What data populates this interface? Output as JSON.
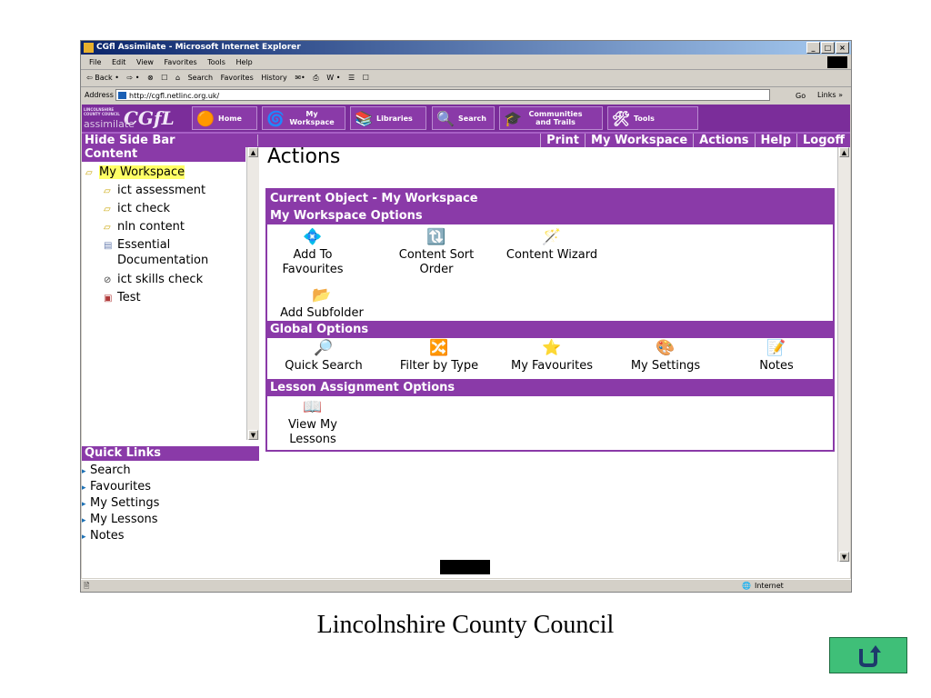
{
  "browser": {
    "title": "CGfl Assimilate - Microsoft Internet Explorer",
    "menu": [
      "File",
      "Edit",
      "View",
      "Favorites",
      "Tools",
      "Help"
    ],
    "toolbar": [
      "⇦ Back •",
      "⇨ •",
      "⊗",
      "☐",
      "⌂",
      "Search",
      "Favorites",
      "History",
      "✉•",
      "⎙",
      "W •",
      "☰",
      "☐"
    ],
    "address_label": "Address",
    "address": "http://cgfl.netlinc.org.uk/",
    "go": "Go",
    "links": "Links »",
    "status_zone": "Internet"
  },
  "app": {
    "logo_lc": "LINCOLNSHIRE COUNTY COUNCIL",
    "logo_cgfl": "CGfL",
    "logo_assimilate": "assimilate",
    "nav": [
      {
        "label": "Home",
        "icon": "home-icon"
      },
      {
        "label": "My Workspace",
        "icon": "workspace-icon"
      },
      {
        "label": "Libraries",
        "icon": "libraries-icon"
      },
      {
        "label": "Search",
        "icon": "search-icon"
      },
      {
        "label": "Communities and Trails",
        "icon": "communities-icon"
      },
      {
        "label": "Tools",
        "icon": "tools-icon"
      }
    ],
    "hide_side_bar": "Hide Side Bar",
    "top_menu": [
      "Print",
      "My Workspace",
      "Actions",
      "Help",
      "Logoff"
    ]
  },
  "sidebar": {
    "content_head": "Content",
    "tree": [
      {
        "label": "My Workspace",
        "selected": true,
        "icon": "folder-open-icon"
      },
      {
        "label": "ict assessment",
        "icon": "folder-icon"
      },
      {
        "label": "ict check",
        "icon": "folder-icon"
      },
      {
        "label": "nln content",
        "icon": "folder-icon"
      },
      {
        "label": "Essential Documentation",
        "icon": "document-icon"
      },
      {
        "label": "ict skills check",
        "icon": "check-icon"
      },
      {
        "label": "Test",
        "icon": "test-icon"
      }
    ],
    "quick_links_head": "Quick Links",
    "quick_links": [
      "Search",
      "Favourites",
      "My Settings",
      "My Lessons",
      "Notes"
    ]
  },
  "main": {
    "title": "Actions",
    "current_object": "Current Object - My Workspace",
    "sections": [
      {
        "head": "My Workspace Options",
        "items": [
          "Add To Favourites",
          "Content Sort Order",
          "Content Wizard",
          "Add Subfolder"
        ]
      },
      {
        "head": "Global Options",
        "items": [
          "Quick Search",
          "Filter by Type",
          "My Favourites",
          "My Settings",
          "Notes"
        ]
      },
      {
        "head": "Lesson Assignment Options",
        "items": [
          "View My Lessons"
        ]
      }
    ]
  },
  "slide": {
    "caption": "Lincolnshire County Council",
    "back_icon": "return-arrow-icon"
  }
}
